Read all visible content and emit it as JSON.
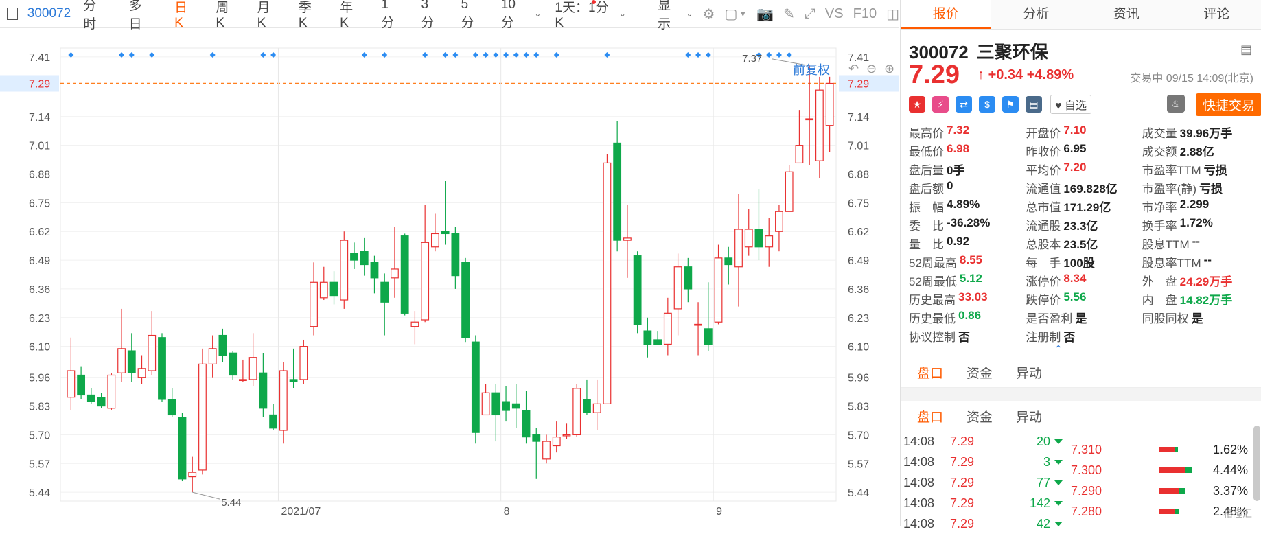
{
  "toolbar": {
    "code": "300072",
    "items": [
      "分时",
      "多日",
      "日K",
      "周K",
      "月K",
      "季K",
      "年K",
      "1分",
      "3分",
      "5分",
      "10分"
    ],
    "active": "日K",
    "period_select": "1天：1分K",
    "display": "显示",
    "vs": "VS",
    "f10": "F10"
  },
  "chart": {
    "fuquan": "前复权",
    "y_labels": [
      "7.41",
      "7.29",
      "7.14",
      "7.01",
      "6.88",
      "6.75",
      "6.62",
      "6.49",
      "6.36",
      "6.23",
      "6.10",
      "5.96",
      "5.83",
      "5.70",
      "5.57",
      "5.44"
    ],
    "current_price_label": "7.29",
    "x_labels": [
      "2021/07",
      "8",
      "9"
    ],
    "high_marker": "7.37",
    "low_marker": "5.44",
    "colors": {
      "up": "#e93030",
      "down": "#0ea84a",
      "dot": "#2b8cf2",
      "priceline": "#ff7f1f"
    }
  },
  "chart_data": {
    "type": "candlestick",
    "ylim": [
      5.4,
      7.45
    ],
    "candles": [
      {
        "o": 5.87,
        "c": 5.99,
        "h": 6.14,
        "l": 5.81
      },
      {
        "o": 5.97,
        "c": 5.88,
        "h": 6.01,
        "l": 5.86
      },
      {
        "o": 5.88,
        "c": 5.85,
        "h": 5.91,
        "l": 5.84
      },
      {
        "o": 5.87,
        "c": 5.83,
        "h": 5.89,
        "l": 5.82
      },
      {
        "o": 5.82,
        "c": 5.97,
        "h": 5.98,
        "l": 5.81
      },
      {
        "o": 5.98,
        "c": 6.09,
        "h": 6.27,
        "l": 5.94
      },
      {
        "o": 6.08,
        "c": 5.98,
        "h": 6.16,
        "l": 5.94
      },
      {
        "o": 5.96,
        "c": 6.0,
        "h": 6.06,
        "l": 5.93
      },
      {
        "o": 5.99,
        "c": 6.15,
        "h": 6.26,
        "l": 5.97
      },
      {
        "o": 6.14,
        "c": 5.86,
        "h": 6.16,
        "l": 5.85
      },
      {
        "o": 5.86,
        "c": 5.79,
        "h": 5.91,
        "l": 5.78
      },
      {
        "o": 5.78,
        "c": 5.5,
        "h": 5.8,
        "l": 5.49
      },
      {
        "o": 5.51,
        "c": 5.53,
        "h": 5.6,
        "l": 5.44
      },
      {
        "o": 5.54,
        "c": 6.02,
        "h": 6.09,
        "l": 5.52
      },
      {
        "o": 6.02,
        "c": 6.09,
        "h": 6.15,
        "l": 5.96
      },
      {
        "o": 6.15,
        "c": 6.06,
        "h": 6.18,
        "l": 6.03
      },
      {
        "o": 6.07,
        "c": 5.97,
        "h": 6.08,
        "l": 5.95
      },
      {
        "o": 5.95,
        "c": 5.95,
        "h": 6.04,
        "l": 5.94
      },
      {
        "o": 5.95,
        "c": 6.05,
        "h": 6.16,
        "l": 5.92
      },
      {
        "o": 5.98,
        "c": 5.82,
        "h": 6.07,
        "l": 5.78
      },
      {
        "o": 5.79,
        "c": 5.73,
        "h": 5.84,
        "l": 5.72
      },
      {
        "o": 5.72,
        "c": 5.99,
        "h": 6.03,
        "l": 5.66
      },
      {
        "o": 5.95,
        "c": 5.94,
        "h": 6.09,
        "l": 5.91
      },
      {
        "o": 5.95,
        "c": 6.1,
        "h": 6.13,
        "l": 5.93
      },
      {
        "o": 6.19,
        "c": 6.39,
        "h": 6.48,
        "l": 6.15
      },
      {
        "o": 6.32,
        "c": 6.39,
        "h": 6.46,
        "l": 6.31
      },
      {
        "o": 6.39,
        "c": 6.33,
        "h": 6.44,
        "l": 6.29
      },
      {
        "o": 6.31,
        "c": 6.58,
        "h": 6.62,
        "l": 6.27
      },
      {
        "o": 6.52,
        "c": 6.49,
        "h": 6.57,
        "l": 6.45
      },
      {
        "o": 6.53,
        "c": 6.47,
        "h": 6.59,
        "l": 6.42
      },
      {
        "o": 6.48,
        "c": 6.41,
        "h": 6.51,
        "l": 6.34
      },
      {
        "o": 6.39,
        "c": 6.3,
        "h": 6.43,
        "l": 6.15
      },
      {
        "o": 6.41,
        "c": 6.45,
        "h": 6.64,
        "l": 6.32
      },
      {
        "o": 6.6,
        "c": 6.25,
        "h": 6.61,
        "l": 6.24
      },
      {
        "o": 6.19,
        "c": 6.21,
        "h": 6.26,
        "l": 6.11
      },
      {
        "o": 6.22,
        "c": 6.57,
        "h": 6.74,
        "l": 6.21
      },
      {
        "o": 6.55,
        "c": 6.61,
        "h": 6.7,
        "l": 6.53
      },
      {
        "o": 6.62,
        "c": 6.61,
        "h": 6.85,
        "l": 6.56
      },
      {
        "o": 6.61,
        "c": 6.42,
        "h": 6.64,
        "l": 6.36
      },
      {
        "o": 6.48,
        "c": 6.14,
        "h": 6.5,
        "l": 6.12
      },
      {
        "o": 6.12,
        "c": 5.71,
        "h": 6.15,
        "l": 5.66
      },
      {
        "o": 5.79,
        "c": 5.89,
        "h": 5.93,
        "l": 5.79
      },
      {
        "o": 5.89,
        "c": 5.79,
        "h": 5.93,
        "l": 5.67
      },
      {
        "o": 5.85,
        "c": 5.81,
        "h": 5.92,
        "l": 5.76
      },
      {
        "o": 5.84,
        "c": 5.82,
        "h": 5.93,
        "l": 5.73
      },
      {
        "o": 5.81,
        "c": 5.69,
        "h": 5.9,
        "l": 5.66
      },
      {
        "o": 5.7,
        "c": 5.67,
        "h": 5.73,
        "l": 5.5
      },
      {
        "o": 5.59,
        "c": 5.67,
        "h": 5.7,
        "l": 5.57
      },
      {
        "o": 5.65,
        "c": 5.69,
        "h": 5.76,
        "l": 5.62
      },
      {
        "o": 5.7,
        "c": 5.7,
        "h": 5.75,
        "l": 5.68
      },
      {
        "o": 5.7,
        "c": 5.91,
        "h": 5.93,
        "l": 5.69
      },
      {
        "o": 5.86,
        "c": 5.8,
        "h": 5.95,
        "l": 5.79
      },
      {
        "o": 5.8,
        "c": 5.84,
        "h": 5.95,
        "l": 5.72
      },
      {
        "o": 5.84,
        "c": 6.93,
        "h": 6.97,
        "l": 5.84
      },
      {
        "o": 7.02,
        "c": 6.58,
        "h": 7.12,
        "l": 6.53
      },
      {
        "o": 6.58,
        "c": 6.59,
        "h": 6.74,
        "l": 6.41
      },
      {
        "o": 6.51,
        "c": 6.2,
        "h": 6.53,
        "l": 6.16
      },
      {
        "o": 6.17,
        "c": 6.11,
        "h": 6.23,
        "l": 6.05
      },
      {
        "o": 6.13,
        "c": 6.11,
        "h": 6.17,
        "l": 6.11
      },
      {
        "o": 6.11,
        "c": 6.25,
        "h": 6.32,
        "l": 6.06
      },
      {
        "o": 6.27,
        "c": 6.46,
        "h": 6.52,
        "l": 6.15
      },
      {
        "o": 6.46,
        "c": 6.36,
        "h": 6.5,
        "l": 6.3
      },
      {
        "o": 6.2,
        "c": 6.2,
        "h": 6.3,
        "l": 6.06
      },
      {
        "o": 6.18,
        "c": 6.11,
        "h": 6.39,
        "l": 6.08
      },
      {
        "o": 6.21,
        "c": 6.5,
        "h": 6.56,
        "l": 6.2
      },
      {
        "o": 6.5,
        "c": 6.47,
        "h": 6.55,
        "l": 6.38
      },
      {
        "o": 6.46,
        "c": 6.63,
        "h": 6.79,
        "l": 6.28
      },
      {
        "o": 6.55,
        "c": 6.63,
        "h": 6.72,
        "l": 6.51
      },
      {
        "o": 6.63,
        "c": 6.55,
        "h": 6.81,
        "l": 6.49
      },
      {
        "o": 6.55,
        "c": 6.6,
        "h": 6.68,
        "l": 6.46
      },
      {
        "o": 6.62,
        "c": 6.71,
        "h": 6.74,
        "l": 6.53
      },
      {
        "o": 6.71,
        "c": 6.89,
        "h": 6.92,
        "l": 6.71
      },
      {
        "o": 6.93,
        "c": 7.01,
        "h": 7.17,
        "l": 6.96
      },
      {
        "o": 7.13,
        "c": 7.13,
        "h": 7.37,
        "l": 6.92
      },
      {
        "o": 6.94,
        "c": 7.26,
        "h": 7.32,
        "l": 6.86
      },
      {
        "o": 7.1,
        "c": 7.29,
        "h": 7.32,
        "l": 6.98
      }
    ]
  },
  "panel": {
    "tabs": [
      "报价",
      "分析",
      "资讯",
      "评论"
    ],
    "active_tab": "报价",
    "code": "300072",
    "name": "三聚环保",
    "price": "7.29",
    "arrow": "↑",
    "change": "+0.34",
    "change_pct": "+4.89%",
    "status": "交易中 09/15 14:09(北京)",
    "fav": "自选",
    "quick_trade": "快捷交易",
    "stats": [
      [
        [
          "最高价",
          "7.32",
          "red"
        ],
        [
          "开盘价",
          "7.10",
          "red"
        ],
        [
          "成交量",
          "39.96万手",
          ""
        ]
      ],
      [
        [
          "最低价",
          "6.98",
          "red"
        ],
        [
          "昨收价",
          "6.95",
          ""
        ],
        [
          "成交额",
          "2.88亿",
          ""
        ]
      ],
      [
        [
          "盘后量",
          "0手",
          ""
        ],
        [
          "平均价",
          "7.20",
          "red"
        ],
        [
          "市盈率TTM",
          "亏损",
          ""
        ]
      ],
      [
        [
          "盘后额",
          "0",
          ""
        ],
        [
          "流通值",
          "169.828亿",
          ""
        ],
        [
          "市盈率(静)",
          "亏损",
          ""
        ]
      ],
      [
        [
          "振　幅",
          "4.89%",
          ""
        ],
        [
          "总市值",
          "171.29亿",
          ""
        ],
        [
          "市净率",
          "2.299",
          ""
        ]
      ],
      [
        [
          "委　比",
          "-36.28%",
          ""
        ],
        [
          "流通股",
          "23.3亿",
          ""
        ],
        [
          "换手率",
          "1.72%",
          ""
        ]
      ],
      [
        [
          "量　比",
          "0.92",
          ""
        ],
        [
          "总股本",
          "23.5亿",
          ""
        ],
        [
          "股息TTM",
          "--",
          ""
        ]
      ],
      [
        [
          "52周最高",
          "8.55",
          "red"
        ],
        [
          "每　手",
          "100股",
          ""
        ],
        [
          "股息率TTM",
          "--",
          ""
        ]
      ],
      [
        [
          "52周最低",
          "5.12",
          "green"
        ],
        [
          "涨停价",
          "8.34",
          "red"
        ],
        [
          "外　盘",
          "24.29万手",
          "red"
        ]
      ],
      [
        [
          "历史最高",
          "33.03",
          "red"
        ],
        [
          "跌停价",
          "5.56",
          "green"
        ],
        [
          "内　盘",
          "14.82万手",
          "green"
        ]
      ],
      [
        [
          "历史最低",
          "0.86",
          "green"
        ],
        [
          "是否盈利",
          "是",
          ""
        ],
        [
          "同股同权",
          "是",
          ""
        ]
      ],
      [
        [
          "协议控制",
          "否",
          ""
        ],
        [
          "注册制",
          "否",
          ""
        ],
        [
          "",
          "",
          ""
        ]
      ]
    ],
    "subtabs": [
      "盘口",
      "资金",
      "异动"
    ],
    "subtab_active": "盘口",
    "ticks": [
      {
        "time": "14:08",
        "price": "7.29",
        "vol": "20"
      },
      {
        "time": "14:08",
        "price": "7.29",
        "vol": "3"
      },
      {
        "time": "14:08",
        "price": "7.29",
        "vol": "77"
      },
      {
        "time": "14:08",
        "price": "7.29",
        "vol": "142"
      },
      {
        "time": "14:08",
        "price": "7.29",
        "vol": "42"
      }
    ],
    "levels": [
      {
        "price": "7.310",
        "pct": "1.62%",
        "red": 0.5,
        "green": 0.2
      },
      {
        "price": "7.300",
        "pct": "4.44%",
        "red": 0.8,
        "green": 0.5
      },
      {
        "price": "7.290",
        "pct": "3.37%",
        "red": 0.6,
        "green": 0.5
      },
      {
        "price": "7.280",
        "pct": "2.48%",
        "red": 0.5,
        "green": 0.3
      }
    ],
    "watermark": "格隆汇"
  }
}
